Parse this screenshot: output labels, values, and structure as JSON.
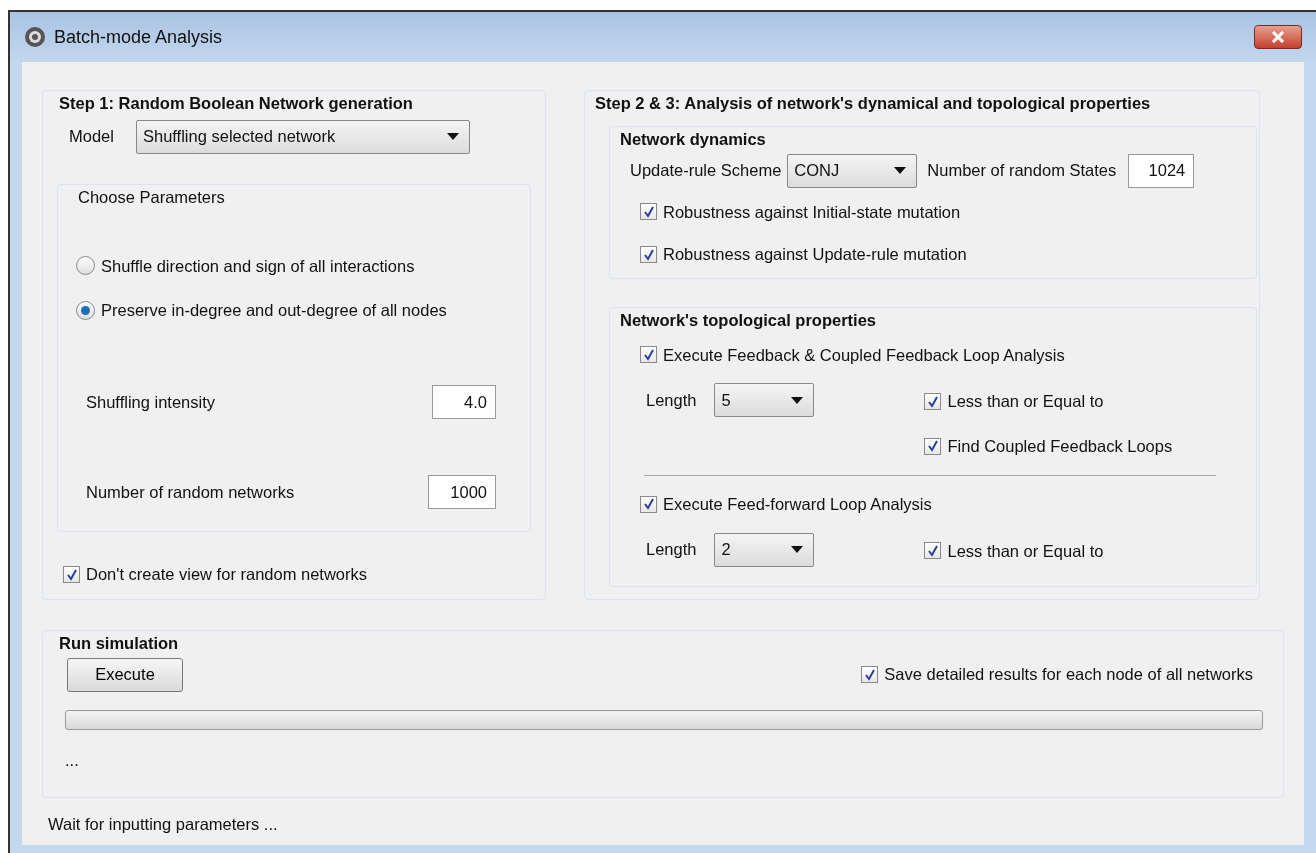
{
  "window": {
    "title": "Batch-mode Analysis"
  },
  "step1": {
    "title": "Step 1: Random Boolean Network generation",
    "model": {
      "label": "Model",
      "value": "Shuffling selected network"
    },
    "parameters": {
      "title": "Choose Parameters",
      "options": [
        {
          "label": "Shuffle direction and sign of all interactions",
          "selected": false
        },
        {
          "label": "Preserve in-degree and out-degree of all nodes",
          "selected": true
        }
      ],
      "fields": [
        {
          "label": "Shuffling intensity",
          "value": "4.0"
        },
        {
          "label": "Number of random networks",
          "value": "1000"
        }
      ]
    },
    "options": [
      {
        "label": "Don't create view for random networks",
        "checked": true
      }
    ]
  },
  "step2": {
    "title": "Step 2 & 3: Analysis of network's dynamical and topological properties",
    "dynamics": {
      "title": "Network dynamics",
      "scheme": {
        "label": "Update-rule Scheme",
        "value": "CONJ"
      },
      "states": {
        "label": "Number of random States",
        "value": "1024"
      },
      "options": [
        {
          "label": "Robustness against Initial-state mutation",
          "checked": true
        },
        {
          "label": "Robustness against Update-rule mutation",
          "checked": true
        }
      ]
    },
    "topology": {
      "title": "Network's topological properties",
      "sections": [
        {
          "execute": {
            "label": "Execute Feedback & Coupled Feedback Loop Analysis",
            "checked": true
          },
          "length": {
            "label": "Length",
            "value": "5"
          },
          "options": [
            {
              "label": "Less than or Equal to",
              "checked": true
            },
            {
              "label": "Find Coupled Feedback Loops",
              "checked": true
            }
          ]
        },
        {
          "execute": {
            "label": "Execute Feed-forward Loop Analysis",
            "checked": true
          },
          "length": {
            "label": "Length",
            "value": "2"
          },
          "options": [
            {
              "label": "Less than or Equal to",
              "checked": true
            }
          ]
        }
      ]
    }
  },
  "run": {
    "title": "Run simulation",
    "button": "Execute",
    "save_option": {
      "label": "Save detailed results for each node of all networks",
      "checked": true
    },
    "progress": {
      "level": 0
    },
    "message": "..."
  },
  "status_bar": "Wait for inputting parameters ..."
}
